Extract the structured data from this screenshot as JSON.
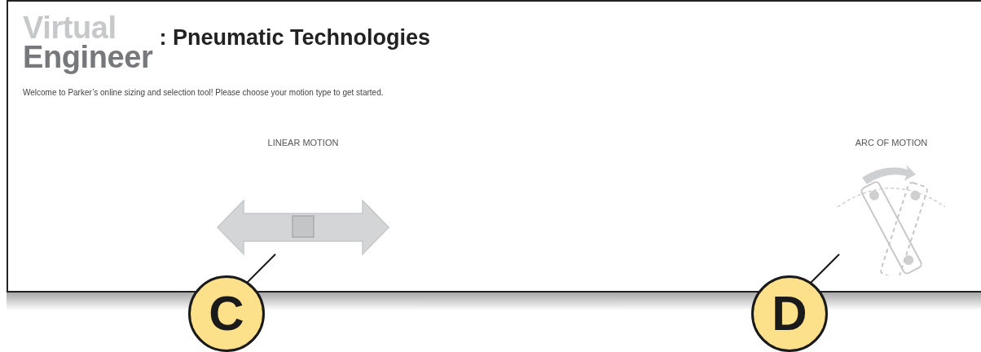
{
  "logo": {
    "line_1": "Virtual",
    "line_2": "Engineer"
  },
  "title": ": Pneumatic Technologies",
  "welcome": "Welcome to Parker’s online sizing and selection tool! Please choose your motion type to get started.",
  "motion_types": [
    {
      "label": "LINEAR MOTION",
      "kind": "linear"
    },
    {
      "label": "ARC OF MOTION",
      "kind": "arc"
    }
  ],
  "callouts": [
    {
      "letter": "C"
    },
    {
      "letter": "D"
    }
  ]
}
